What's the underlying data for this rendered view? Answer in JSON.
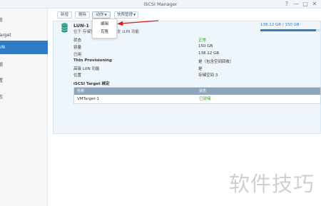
{
  "window": {
    "title": "iSCSI Manager",
    "controls": [
      "?",
      "—",
      "□",
      "✕"
    ]
  },
  "sidebar": {
    "items": [
      {
        "label": "览",
        "active": false
      },
      {
        "label": "Target",
        "active": false
      },
      {
        "label": "UN",
        "active": true
      },
      {
        "label": "照",
        "active": false
      },
      {
        "label": "置",
        "active": false
      },
      {
        "label": "志",
        "active": false
      }
    ]
  },
  "toolbar": {
    "buttons": [
      {
        "label": "新增"
      },
      {
        "label": "删除"
      },
      {
        "label": "动作",
        "dropdown": true
      },
      {
        "label": "快照管理",
        "dropdown": true
      }
    ]
  },
  "dropdown_menu": {
    "items": [
      "编辑",
      "克隆"
    ]
  },
  "lun": {
    "name": "LUN-1",
    "description_left": "位于 存储空",
    "description_right": "支 LUN 功能",
    "capacity_text": "138.12 GB / 150 GB",
    "capacity_fraction": 0.92,
    "colors": {
      "accent": "#2f7cc6",
      "ok": "#3a9a2a"
    },
    "properties": [
      {
        "label": "状态",
        "value": "正常",
        "status": "ok"
      },
      {
        "label": "容量",
        "value": "150 GB"
      },
      {
        "label": "已用",
        "value": "138.12 GB"
      },
      {
        "label": "Thin Provisioning",
        "value": "是（包含空间回收）",
        "bold": true
      },
      {
        "label": "高级 LUN 功能",
        "value": "是"
      },
      {
        "label": "位置",
        "value": "存储空间 3"
      }
    ]
  },
  "targets": {
    "title": "iSCSI Target 绑定",
    "columns": [
      "名称",
      "状态"
    ],
    "rows": [
      {
        "name": "VMTarget-1",
        "status": "已就绪"
      }
    ]
  },
  "watermark": "软件技巧"
}
